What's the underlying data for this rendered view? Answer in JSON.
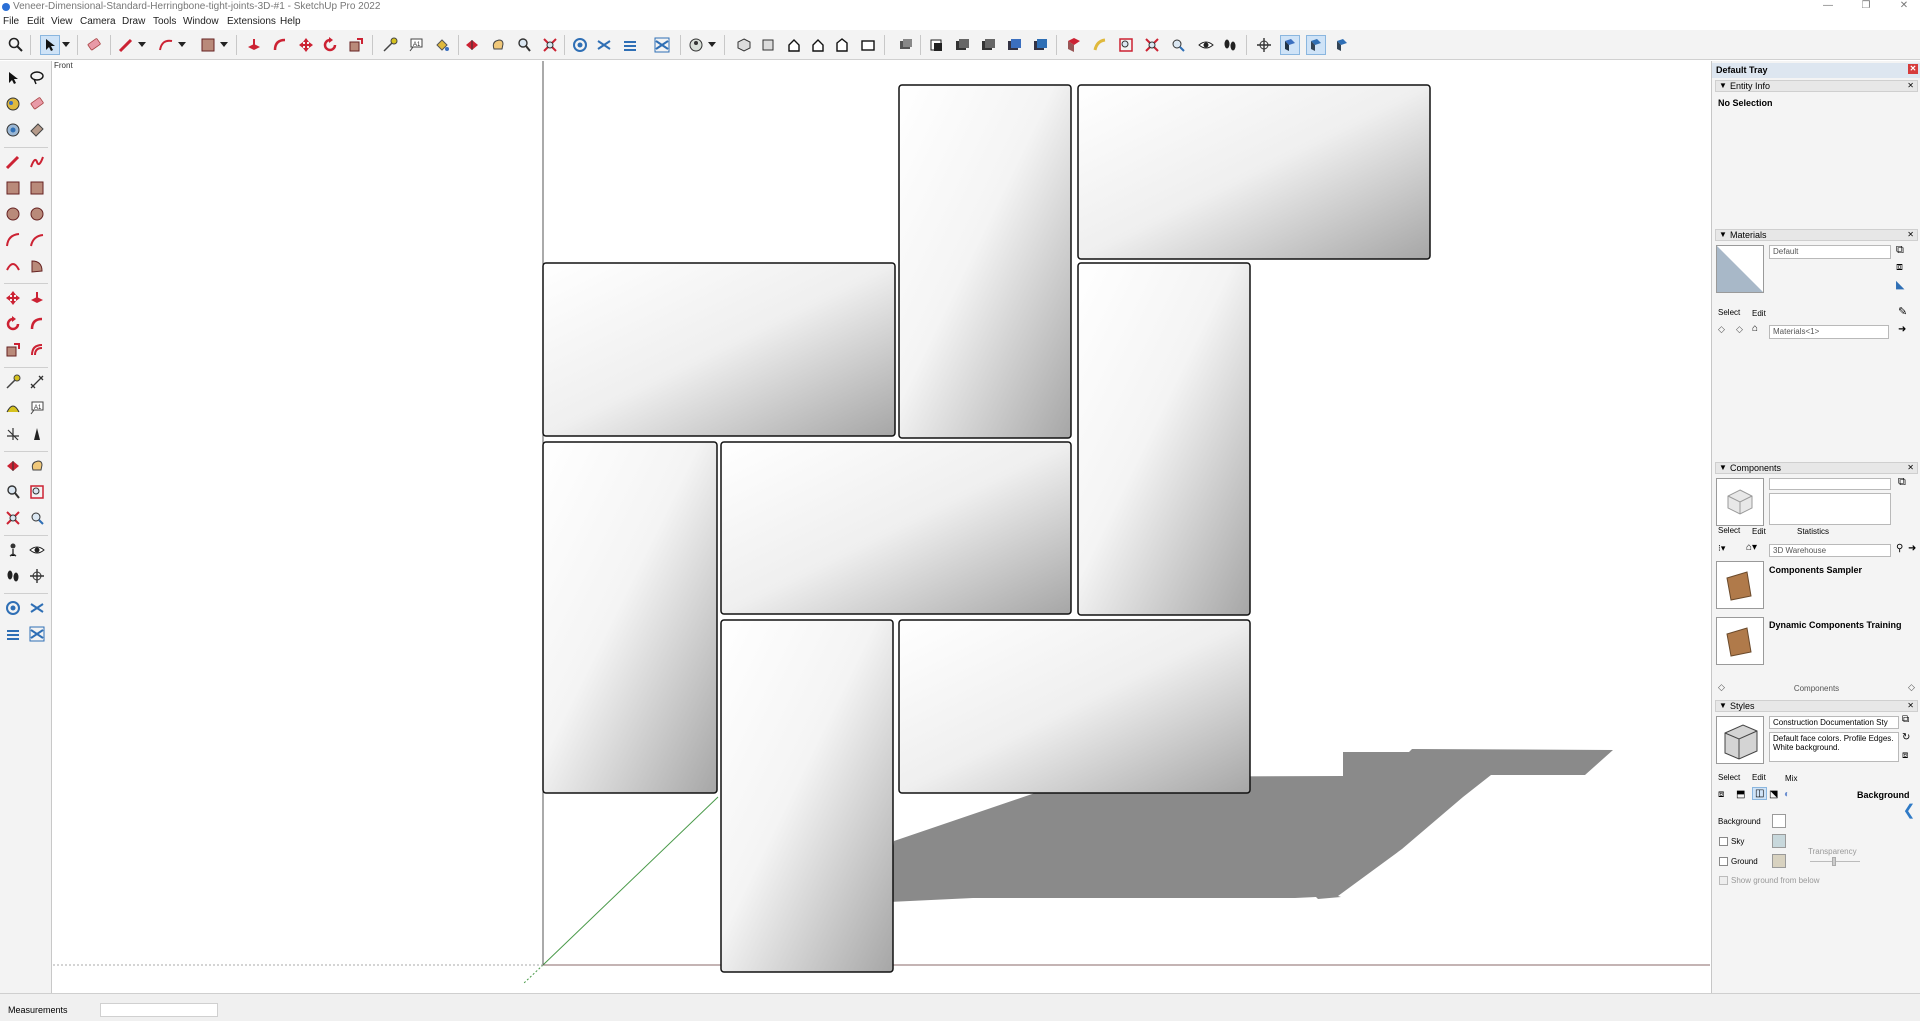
{
  "window": {
    "title": "Veneer-Dimensional-Standard-Herringbone-tight-joints-3D-#1 - SketchUp Pro 2022",
    "minimize": "—",
    "maximize": "❐",
    "close": "✕"
  },
  "menu": [
    "File",
    "Edit",
    "View",
    "Camera",
    "Draw",
    "Tools",
    "Window",
    "Extensions",
    "Help"
  ],
  "viewport": {
    "scene_label": "Front"
  },
  "tray": {
    "title": "Default Tray",
    "entity_info": {
      "header": "Entity Info",
      "selection": "No Selection"
    },
    "materials": {
      "header": "Materials",
      "name": "Default",
      "tab_select": "Select",
      "tab_edit": "Edit",
      "library": "Materials<1>",
      "swatch_color": "#a8b8c8"
    },
    "components": {
      "header": "Components",
      "tab_select": "Select",
      "tab_edit": "Edit",
      "tab_statistics": "Statistics",
      "search_placeholder": "3D Warehouse",
      "items": [
        "Components Sampler",
        "Dynamic Components Training"
      ],
      "footer": "Components"
    },
    "styles": {
      "header": "Styles",
      "name": "Construction Documentation Sty",
      "description": "Default face colors. Profile Edges. White background.",
      "tab_select": "Select",
      "tab_edit": "Edit",
      "tab_mix": "Mix",
      "panel_title": "Background",
      "background_label": "Background",
      "sky_label": "Sky",
      "ground_label": "Ground",
      "transparency_label": "Transparency",
      "show_ground_label": "Show ground from below",
      "background_color": "#ffffff",
      "sky_color": "#c8d8dc",
      "ground_color": "#d8d2c0"
    }
  },
  "status": {
    "measurements_label": "Measurements",
    "measurements_value": ""
  },
  "colors": {
    "accent": "#2f7ac6",
    "shadow": "#8a8a8a",
    "tray_header": "#dde6f0"
  }
}
